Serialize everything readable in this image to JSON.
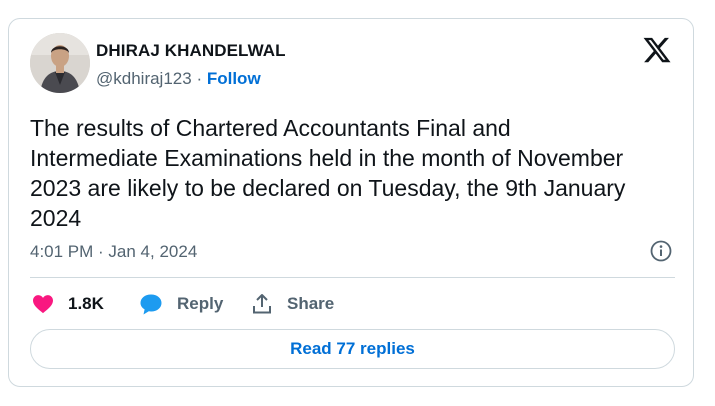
{
  "author": {
    "name": "DHIRAJ KHANDELWAL",
    "handle": "@kdhiraj123",
    "separator": "·",
    "follow_label": "Follow"
  },
  "tweet": {
    "text": "The results of Chartered Accountants Final and Intermediate Examinations held in the month of November 2023 are likely to be declared on Tuesday, the 9th January 2024",
    "timestamp": "4:01 PM · Jan 4, 2024"
  },
  "actions": {
    "like_count": "1.8K",
    "reply_label": "Reply",
    "share_label": "Share",
    "read_replies_label": "Read 77 replies"
  },
  "icons": {
    "logo": "x-logo-icon",
    "info": "info-icon",
    "like": "heart-icon",
    "reply": "chat-bubble-icon",
    "share": "share-upload-icon"
  },
  "colors": {
    "heart": "#f91880",
    "reply_bubble": "#1d9bf0",
    "link": "#006fd6",
    "secondary_text": "#536471",
    "border": "#cfd9de"
  }
}
